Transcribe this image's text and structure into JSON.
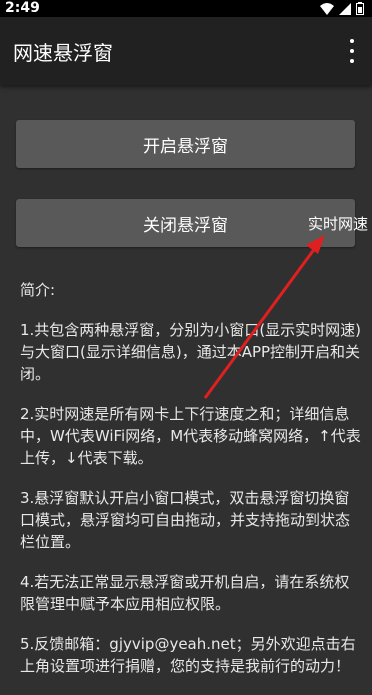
{
  "status_bar": {
    "time": "2:49",
    "icons": [
      "wifi-icon",
      "signal-icon",
      "battery-icon"
    ]
  },
  "app_bar": {
    "title": "网速悬浮窗",
    "menu_icon": "more-vert-icon"
  },
  "buttons": {
    "open": "开启悬浮窗",
    "close": "关闭悬浮窗"
  },
  "floating_window": {
    "text": "实时网速"
  },
  "intro": {
    "heading": "简介:",
    "p1": "1.共包含两种悬浮窗，分别为小窗口(显示实时网速)与大窗口(显示详细信息)，通过本APP控制开启和关闭。",
    "p2": "2.实时网速是所有网卡上下行速度之和；详细信息中，W代表WiFi网络，M代表移动蜂窝网络，↑代表上传，↓代表下载。",
    "p3": "3.悬浮窗默认开启小窗口模式，双击悬浮窗切换窗口模式，悬浮窗均可自由拖动，并支持拖动到状态栏位置。",
    "p4": "4.若无法正常显示悬浮窗或开机自启，请在系统权限管理中赋予本应用相应权限。",
    "p5": "5.反馈邮箱：gjyvip@yeah.net；另外欢迎点击右上角设置项进行捐赠，您的支持是我前行的动力！"
  },
  "colors": {
    "background": "#303030",
    "app_bar": "#212121",
    "button": "#595959",
    "annotation_arrow": "#e02020"
  }
}
